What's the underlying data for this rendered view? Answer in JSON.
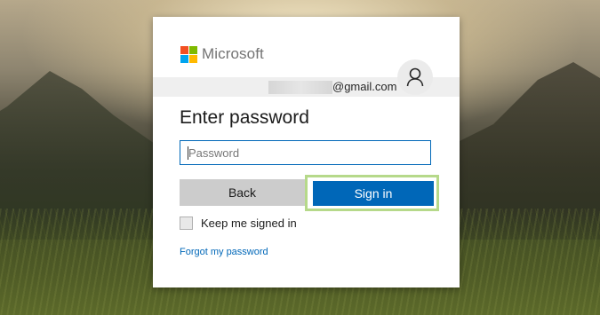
{
  "background": {
    "scene": "mountain-landscape-with-grass"
  },
  "brand": {
    "name": "Microsoft",
    "logo_colors": [
      "#f25022",
      "#7fba00",
      "#00a4ef",
      "#ffb900"
    ]
  },
  "identity": {
    "email_suffix": "@gmail.com",
    "avatar_icon": "person-icon"
  },
  "heading": "Enter password",
  "password_field": {
    "placeholder": "Password",
    "value": ""
  },
  "buttons": {
    "back_label": "Back",
    "signin_label": "Sign in"
  },
  "keep_signed_in": {
    "label": "Keep me signed in",
    "checked": false
  },
  "forgot_link": "Forgot my password",
  "colors": {
    "accent": "#0067b8",
    "secondary_button": "#cccccc",
    "focus_highlight": "#b6d98a"
  }
}
